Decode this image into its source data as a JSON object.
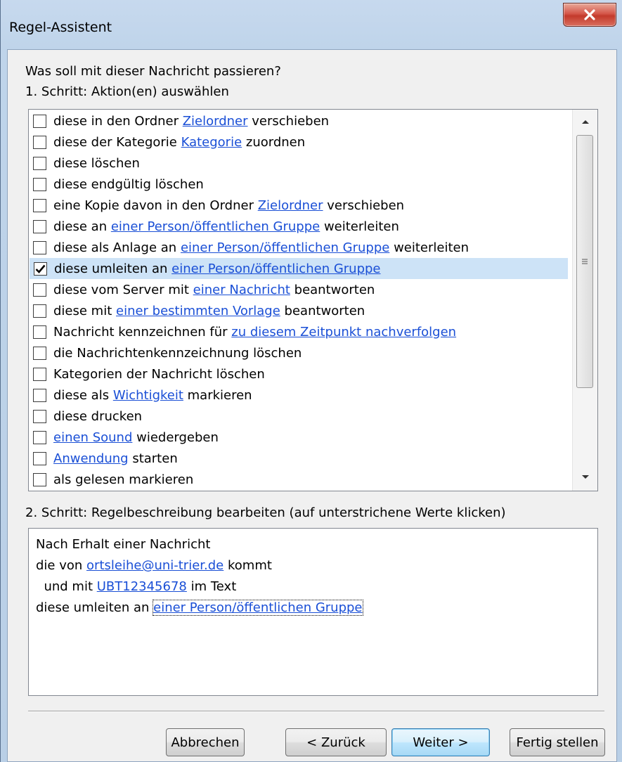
{
  "window": {
    "title": "Regel-Assistent"
  },
  "step1": {
    "question": "Was soll mit dieser Nachricht passieren?",
    "label": "1. Schritt: Aktion(en) auswählen",
    "items": [
      {
        "checked": false,
        "parts": [
          {
            "t": "diese in den Ordner "
          },
          {
            "t": "Zielordner",
            "link": true
          },
          {
            "t": " verschieben"
          }
        ]
      },
      {
        "checked": false,
        "parts": [
          {
            "t": "diese der Kategorie "
          },
          {
            "t": "Kategorie",
            "link": true
          },
          {
            "t": " zuordnen"
          }
        ]
      },
      {
        "checked": false,
        "parts": [
          {
            "t": "diese löschen"
          }
        ]
      },
      {
        "checked": false,
        "parts": [
          {
            "t": "diese endgültig löschen"
          }
        ]
      },
      {
        "checked": false,
        "parts": [
          {
            "t": "eine Kopie davon in den Ordner "
          },
          {
            "t": "Zielordner",
            "link": true
          },
          {
            "t": " verschieben"
          }
        ]
      },
      {
        "checked": false,
        "parts": [
          {
            "t": "diese an "
          },
          {
            "t": "einer Person/öffentlichen Gruppe",
            "link": true
          },
          {
            "t": " weiterleiten"
          }
        ]
      },
      {
        "checked": false,
        "parts": [
          {
            "t": "diese als Anlage an "
          },
          {
            "t": "einer Person/öffentlichen Gruppe",
            "link": true
          },
          {
            "t": " weiterleiten"
          }
        ]
      },
      {
        "checked": true,
        "selected": true,
        "parts": [
          {
            "t": "diese umleiten an "
          },
          {
            "t": "einer Person/öffentlichen Gruppe",
            "link": true
          }
        ]
      },
      {
        "checked": false,
        "parts": [
          {
            "t": "diese vom Server mit "
          },
          {
            "t": "einer Nachricht",
            "link": true
          },
          {
            "t": " beantworten"
          }
        ]
      },
      {
        "checked": false,
        "parts": [
          {
            "t": "diese mit "
          },
          {
            "t": "einer bestimmten Vorlage",
            "link": true
          },
          {
            "t": " beantworten"
          }
        ]
      },
      {
        "checked": false,
        "parts": [
          {
            "t": "Nachricht kennzeichnen für "
          },
          {
            "t": "zu diesem Zeitpunkt nachverfolgen",
            "link": true
          }
        ]
      },
      {
        "checked": false,
        "parts": [
          {
            "t": "die Nachrichtenkennzeichnung löschen"
          }
        ]
      },
      {
        "checked": false,
        "parts": [
          {
            "t": "Kategorien der Nachricht löschen"
          }
        ]
      },
      {
        "checked": false,
        "parts": [
          {
            "t": "diese als "
          },
          {
            "t": "Wichtigkeit",
            "link": true
          },
          {
            "t": " markieren"
          }
        ]
      },
      {
        "checked": false,
        "parts": [
          {
            "t": "diese drucken"
          }
        ]
      },
      {
        "checked": false,
        "parts": [
          {
            "t": "einen Sound",
            "link": true
          },
          {
            "t": " wiedergeben"
          }
        ]
      },
      {
        "checked": false,
        "parts": [
          {
            "t": "Anwendung",
            "link": true
          },
          {
            "t": " starten"
          }
        ]
      },
      {
        "checked": false,
        "parts": [
          {
            "t": "als gelesen markieren"
          }
        ]
      }
    ]
  },
  "step2": {
    "label": "2. Schritt: Regelbeschreibung bearbeiten (auf unterstrichene Werte klicken)",
    "lines": [
      [
        {
          "t": "Nach Erhalt einer Nachricht"
        }
      ],
      [
        {
          "t": "die von "
        },
        {
          "t": "ortsleihe@uni-trier.de",
          "link": true
        },
        {
          "t": " kommt"
        }
      ],
      [
        {
          "t": "  und mit "
        },
        {
          "t": "UBT12345678",
          "link": true
        },
        {
          "t": " im Text"
        }
      ],
      [
        {
          "t": "diese umleiten an "
        },
        {
          "t": "einer Person/öffentlichen Gruppe",
          "link": true,
          "focused": true
        }
      ]
    ]
  },
  "buttons": {
    "cancel": "Abbrechen",
    "back": "< Zurück",
    "next": "Weiter >",
    "finish": "Fertig stellen"
  },
  "icons": {
    "close": "close-icon",
    "check": "checkmark-icon",
    "scroll_up": "scroll-up-icon",
    "scroll_down": "scroll-down-icon",
    "grip": "scroll-grip-icon"
  },
  "colors": {
    "link": "#1a4fd6",
    "selection": "#cde3f7",
    "close_button": "#c33a2b"
  }
}
